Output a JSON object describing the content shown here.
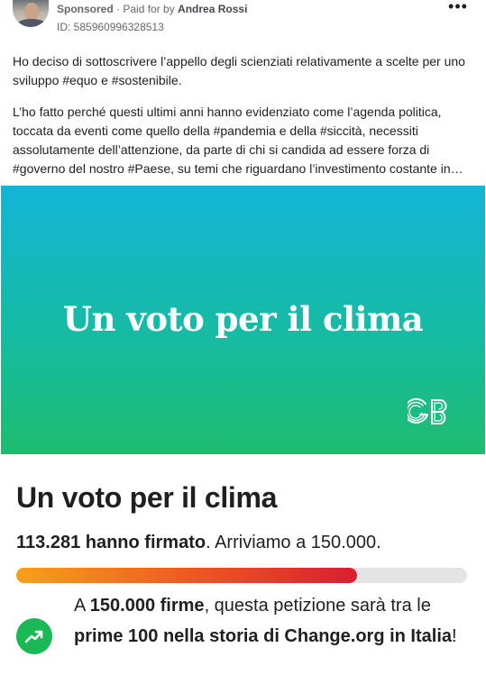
{
  "post": {
    "sponsored_label": "Sponsored",
    "separator": " · ",
    "paid_for_label": "Paid for by ",
    "advertiser": "Andrea Rossi",
    "ad_id": "ID: 585960996328513",
    "more_icon": "more-horizontal-icon",
    "more_label": "•••"
  },
  "body": {
    "paragraph_1": "Ho deciso di sottoscrivere l’appello degli scienziati relativamente a scelte per uno sviluppo #equo e #sostenibile.",
    "paragraph_2": "L’ho fatto perché questi ultimi anni hanno evidenziato come l’agenda politica, toccata da eventi come quello della #pandemia e della #siccità, necessiti assolutamente dell’attenzione, da parte di chi si candida ad essere forza di #governo del nostro #Paese, su temi che riguardano l’investimento costante in…"
  },
  "banner": {
    "title": "Un voto per il clima",
    "logo_text": "GB",
    "colors": {
      "top": "#12b5d6",
      "bottom": "#1dbd6e"
    }
  },
  "petition": {
    "title": "Un voto per il clima",
    "signed_count": "113.281 hanno firmato",
    "goal_text": ". Arriviamo a 150.000.",
    "progress_fraction": 0.755,
    "milestone": {
      "p1": "A ",
      "b1": "150.000 firme",
      "p2": ", questa petizione sarà tra le ",
      "b2": "prime 100 nella storia di Change.org in Italia",
      "p3": "!"
    },
    "trend_icon": "trending-up-icon",
    "colors": {
      "accent": "#1cb855",
      "progress_start": "#f6a11a",
      "progress_end": "#d81f2f"
    }
  }
}
